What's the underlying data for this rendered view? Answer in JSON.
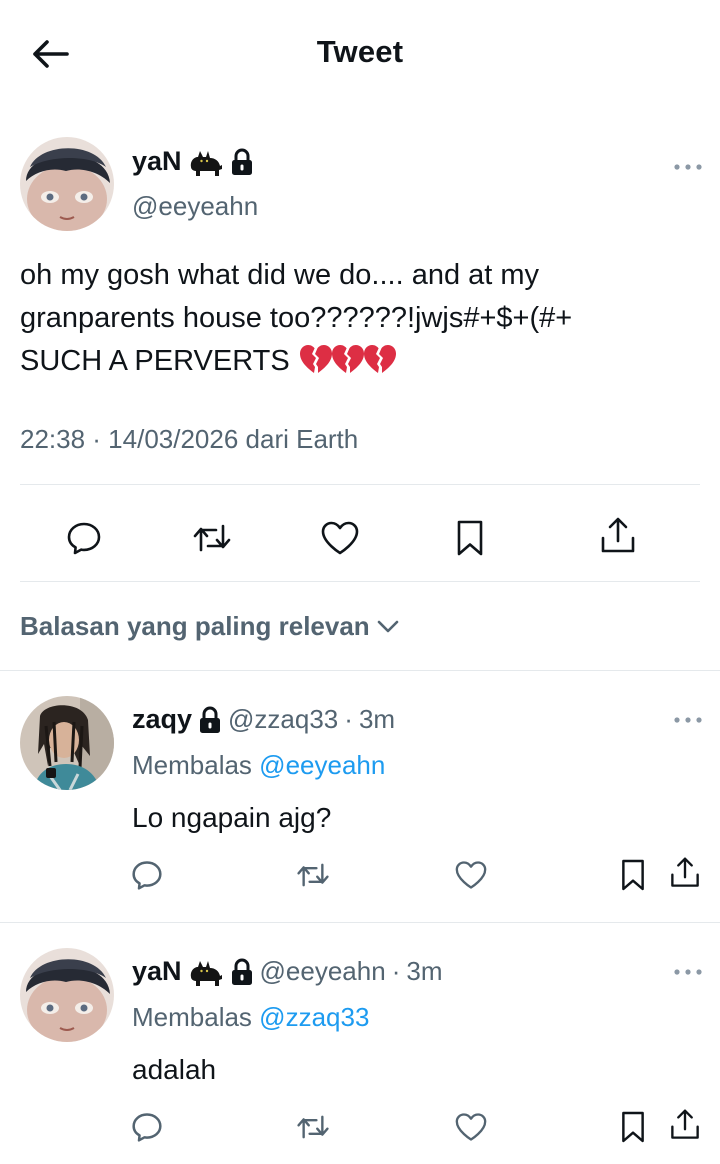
{
  "header": {
    "title": "Tweet",
    "back_icon": "arrow-left-icon"
  },
  "main_tweet": {
    "display_name": "yaN",
    "name_emoji": "cat-emoji",
    "lock_icon": "lock-icon",
    "handle": "@eeyeahn",
    "text_lines": [
      "oh my gosh what did we do.... and at my",
      "granparents house too??????!jwjs#+$+(#+",
      "SUCH A PERVERTS"
    ],
    "emoji_count": 3,
    "emoji": "broken-heart-emoji",
    "timestamp": "22:38 · 14/03/2026 dari Earth",
    "actions": [
      "reply-icon",
      "retweet-icon",
      "like-icon",
      "bookmark-icon",
      "share-icon"
    ]
  },
  "sort": {
    "label": "Balasan yang paling relevan",
    "icon": "chevron-down-icon"
  },
  "replies": [
    {
      "display_name": "zaqy",
      "handle": "@zzaq33",
      "sep": "·",
      "time": "3m",
      "replying_prefix": "Membalas",
      "replying_to": "@eeyeahn",
      "text": "Lo ngapain ajg?"
    },
    {
      "display_name": "yaN",
      "handle": "@eeyeahn",
      "sep": "·",
      "time": "3m",
      "replying_prefix": "Membalas",
      "replying_to": "@zzaq33",
      "text": "adalah"
    }
  ],
  "colors": {
    "text": "#0f1419",
    "secondary": "#536471",
    "link": "#1d9bf0",
    "divider": "#e5e9ec",
    "heart": "#dd2e44"
  }
}
